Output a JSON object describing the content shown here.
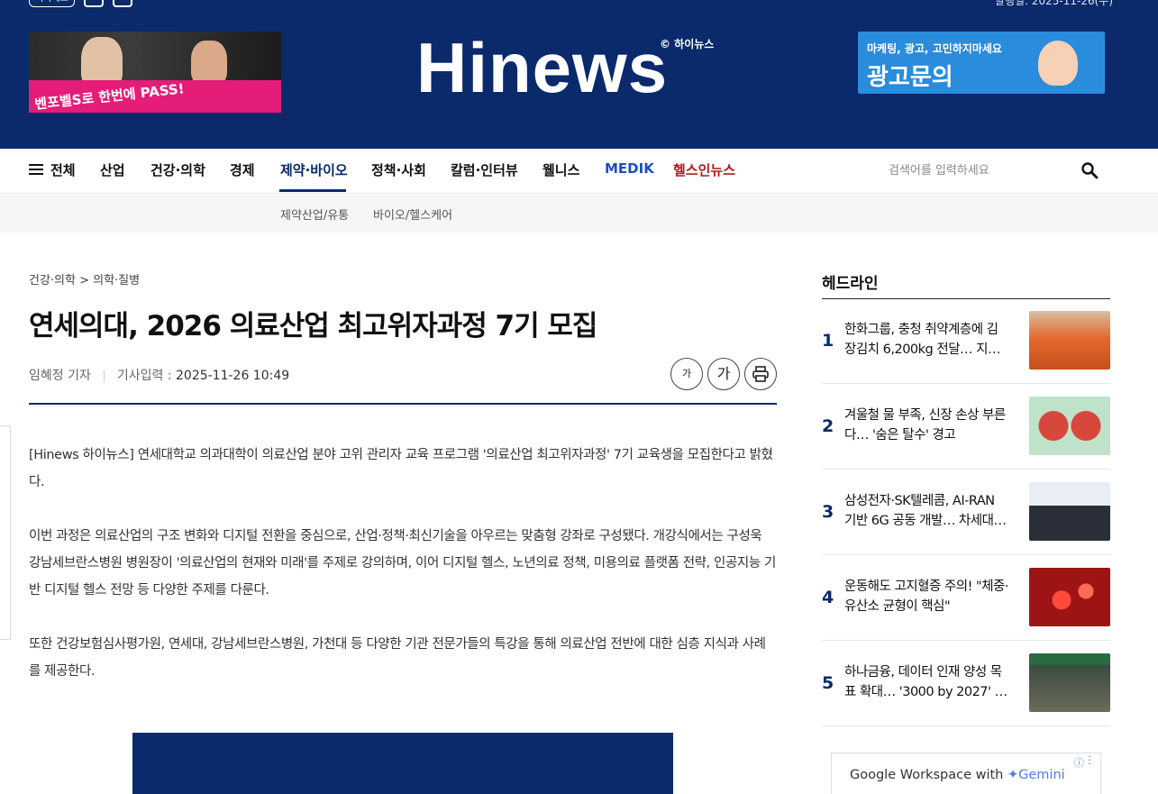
{
  "header": {
    "top_button": "기사제보",
    "date_text": "발행일: 2025-11-26(수)",
    "logo_text": "Hinews",
    "logo_sub": "© 하이뉴스",
    "ad_left_text": "벤포벨S로 한번에 PASS!",
    "ad_right_line1": "마케팅, 광고, 고민하지마세요",
    "ad_right_line2": "광고문의"
  },
  "nav": {
    "items": [
      {
        "label": "전체"
      },
      {
        "label": "산업"
      },
      {
        "label": "건강·의학"
      },
      {
        "label": "경제"
      },
      {
        "label": "제약·바이오"
      },
      {
        "label": "정책·사회"
      },
      {
        "label": "칼럼·인터뷰"
      },
      {
        "label": "웰니스"
      },
      {
        "label": "MEDIK"
      },
      {
        "label": "헬스인뉴스"
      }
    ],
    "search_placeholder": "검색어를 입력하세요",
    "sub_items": [
      "제약산업/유통",
      "바이오/헬스케어"
    ],
    "colors": {
      "medik": "#1d4fb8",
      "healthin": "#b31b1b",
      "active": "#0a2a6b"
    }
  },
  "article": {
    "breadcrumb": "건강·의학 > 의학·질병",
    "title": "연세의대, 2026 의료산업 최고위자과정 7기 모집",
    "author": "임혜정 기자",
    "date_label": "기사입력 :",
    "date": "2025-11-26 10:49",
    "font_small_label": "가",
    "font_large_label": "가",
    "paragraphs": [
      "[Hinews 하이뉴스] 연세대학교 의과대학이 의료산업 분야 고위 관리자 교육 프로그램 '의료산업 최고위자과정' 7기 교육생을 모집한다고 밝혔다.",
      "이번 과정은 의료산업의 구조 변화와 디지털 전환을 중심으로, 산업·정책·최신기술을 아우르는 맞춤형 강좌로 구성됐다. 개강식에서는 구성욱 강남세브란스병원 병원장이 '의료산업의 현재와 미래'를 주제로 강의하며, 이어 디지털 헬스, 노년의료 정책, 미용의료 플랫폼 전략, 인공지능 기반 디지털 헬스 전망 등 다양한 주제를 다룬다.",
      "또한 건강보험심사평가원, 연세대, 강남세브란스병원, 가천대 등 다양한 기관 전문가들의 특강을 통해 의료산업 전반에 대한 심층 지식과 사례를 제공한다."
    ]
  },
  "sidebar": {
    "title": "헤드라인",
    "headlines": [
      {
        "num": "1",
        "text": "한화그룹, 충청 취약계층에 김장김치 6,200kg 전달… 지…"
      },
      {
        "num": "2",
        "text": "겨울철 물 부족, 신장 손상 부른다… '숨은 탈수' 경고"
      },
      {
        "num": "3",
        "text": "삼성전자·SK텔레콤, AI-RAN 기반 6G 공동 개발… 차세대…"
      },
      {
        "num": "4",
        "text": "운동해도 고지혈증 주의! \"체중·유산소 균형이 핵심\""
      },
      {
        "num": "5",
        "text": "하나금융, 데이터 인재 양성 목표 확대… '3000 by 2027' …"
      }
    ]
  },
  "ad": {
    "text": "Google Workspace with",
    "brand": "Gemini"
  }
}
